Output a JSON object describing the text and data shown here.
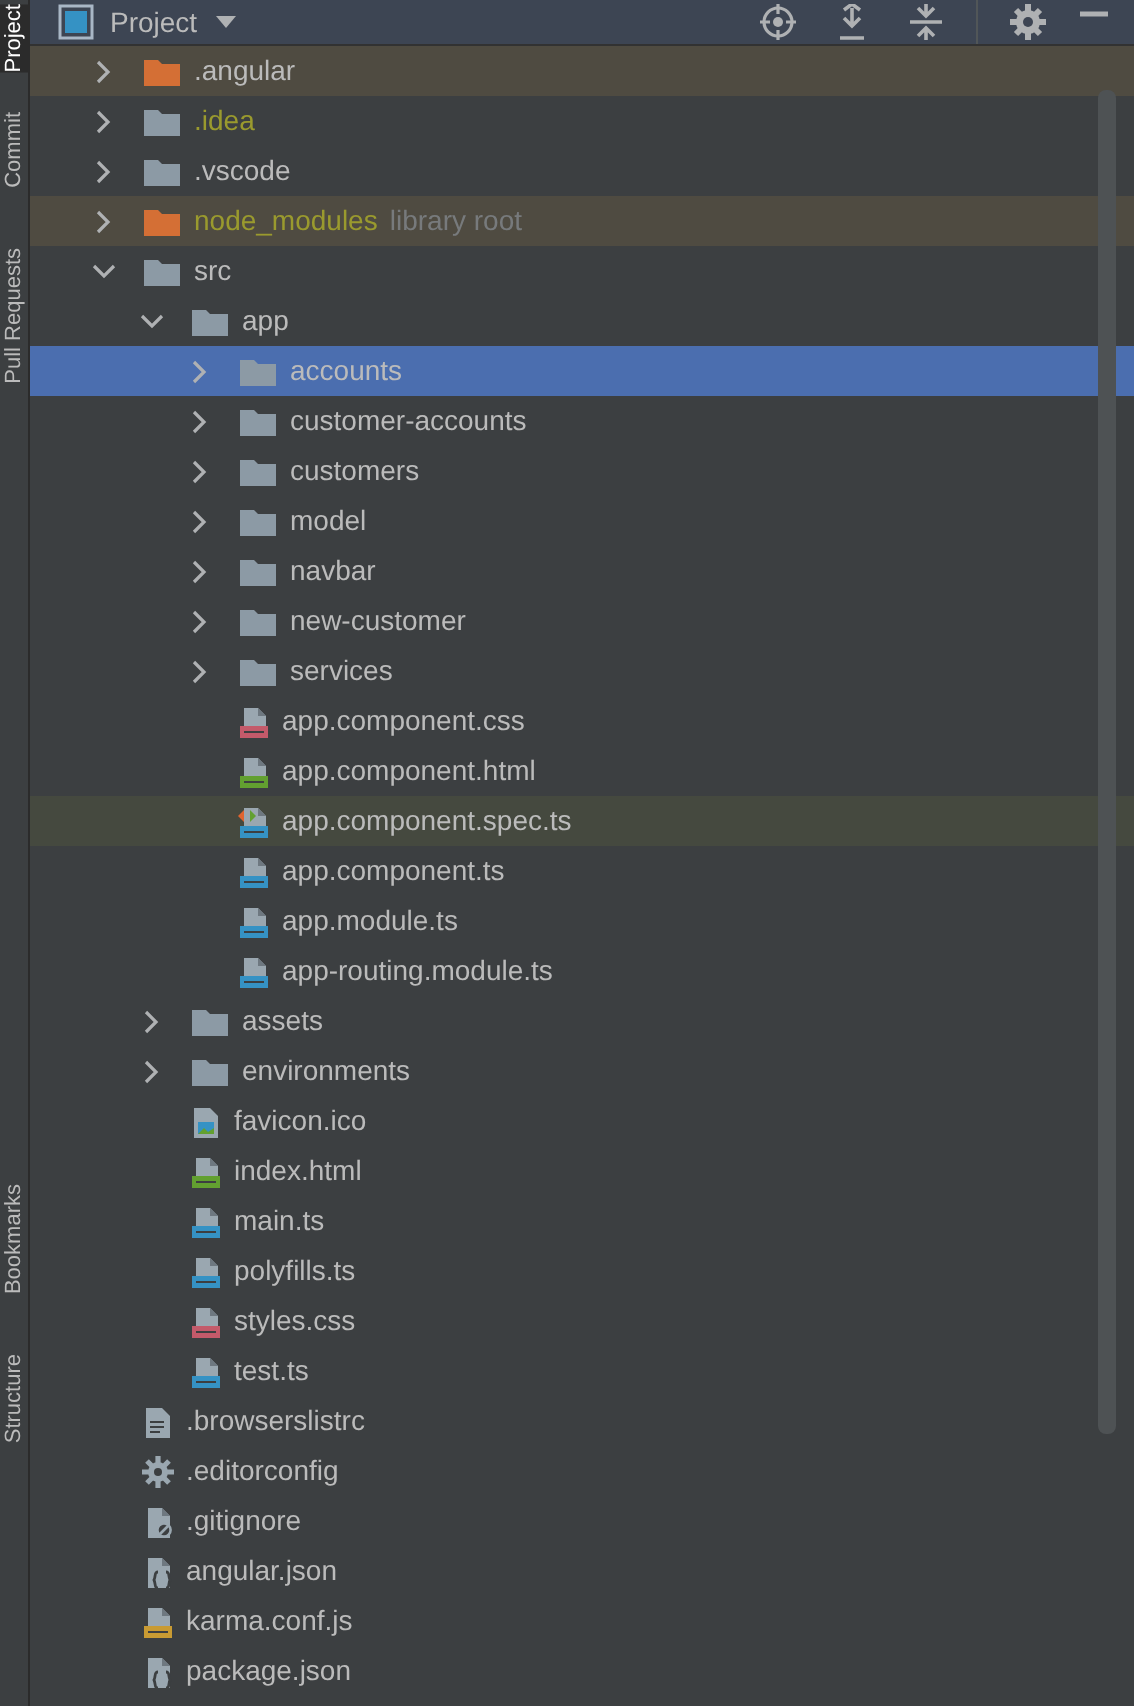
{
  "tool_strip": [
    {
      "label": "Project",
      "selected": true
    },
    {
      "label": "Commit",
      "selected": false
    },
    {
      "label": "Pull Requests",
      "selected": false
    },
    {
      "label": "Bookmarks",
      "selected": false
    },
    {
      "label": "Structure",
      "selected": false
    }
  ],
  "header": {
    "title": "Project"
  },
  "tree": [
    {
      "name": ".angular",
      "kind": "folder",
      "expanded": false,
      "excluded": true,
      "ignored": false
    },
    {
      "name": ".idea",
      "kind": "folder",
      "expanded": false,
      "excluded": false,
      "ignored": true
    },
    {
      "name": ".vscode",
      "kind": "folder",
      "expanded": false,
      "excluded": false,
      "ignored": false
    },
    {
      "name": "node_modules",
      "note": "library root",
      "kind": "folder",
      "expanded": false,
      "excluded": true,
      "ignored": true
    },
    {
      "name": "src",
      "kind": "folder",
      "expanded": true,
      "excluded": false,
      "ignored": false,
      "children": [
        {
          "name": "app",
          "kind": "folder",
          "expanded": true,
          "excluded": false,
          "ignored": false,
          "children": [
            {
              "name": "accounts",
              "kind": "folder",
              "expanded": false,
              "selected": true
            },
            {
              "name": "customer-accounts",
              "kind": "folder",
              "expanded": false,
              "selected": false
            },
            {
              "name": "customers",
              "kind": "folder",
              "expanded": false,
              "selected": false
            },
            {
              "name": "model",
              "kind": "folder",
              "expanded": false,
              "selected": false
            },
            {
              "name": "navbar",
              "kind": "folder",
              "expanded": false,
              "selected": false
            },
            {
              "name": "new-customer",
              "kind": "folder",
              "expanded": false,
              "selected": false
            },
            {
              "name": "services",
              "kind": "folder",
              "expanded": false,
              "selected": false
            },
            {
              "name": "app.component.css",
              "kind": "css",
              "selected": false
            },
            {
              "name": "app.component.html",
              "kind": "html",
              "selected": false
            },
            {
              "name": "app.component.spec.ts",
              "kind": "spec",
              "selected": false,
              "highlighted": true
            },
            {
              "name": "app.component.ts",
              "kind": "ts",
              "selected": false
            },
            {
              "name": "app.module.ts",
              "kind": "ts",
              "selected": false
            },
            {
              "name": "app-routing.module.ts",
              "kind": "ts",
              "selected": false
            }
          ]
        },
        {
          "name": "assets",
          "kind": "folder",
          "expanded": false
        },
        {
          "name": "environments",
          "kind": "folder",
          "expanded": false
        },
        {
          "name": "favicon.ico",
          "kind": "image"
        },
        {
          "name": "index.html",
          "kind": "html"
        },
        {
          "name": "main.ts",
          "kind": "ts"
        },
        {
          "name": "polyfills.ts",
          "kind": "ts"
        },
        {
          "name": "styles.css",
          "kind": "css"
        },
        {
          "name": "test.ts",
          "kind": "ts"
        }
      ]
    },
    {
      "name": ".browserslistrc",
      "kind": "text"
    },
    {
      "name": ".editorconfig",
      "kind": "gear"
    },
    {
      "name": ".gitignore",
      "kind": "ignore"
    },
    {
      "name": "angular.json",
      "kind": "json"
    },
    {
      "name": "karma.conf.js",
      "kind": "js"
    },
    {
      "name": "package.json",
      "kind": "json"
    }
  ]
}
